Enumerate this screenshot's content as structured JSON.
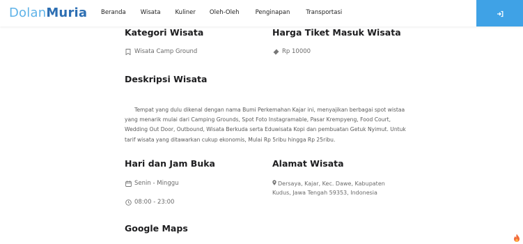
{
  "header": {
    "logo_part1": "Dolan",
    "logo_part2": "Muria",
    "nav": [
      "Beranda",
      "Wisata",
      "Kuliner",
      "Oleh-Oleh",
      "Penginapan",
      "Transportasi"
    ],
    "accent": "#3fa2e6"
  },
  "kategori": {
    "title": "Kategori Wisata",
    "value": "Wisata Camp Ground",
    "icon": "bookmark-icon"
  },
  "harga": {
    "title": "Harga Tiket Masuk Wisata",
    "value": "Rp 10000",
    "icon": "ticket-icon"
  },
  "deskripsi": {
    "title": "Deskripsi Wisata",
    "text": "Tempat yang dulu dikenal dengan nama Bumi Perkemahan Kajar ini, menyajikan berbagai spot wistaa yang menarik mulai dari Camping Grounds, Spot Foto Instagramable, Pasar Krempyeng, Food Court, Wedding Out Door, Outbound, Wisata Berkuda serta Eduwisata Kopi dan pembuatan Getuk Nyimut. Untuk tarif wisata yang ditawarkan cukup ekonomis, Mulai Rp 5ribu hingga Rp 25ribu."
  },
  "jam": {
    "title": "Hari dan Jam Buka",
    "days": "Senin - Minggu",
    "hours": "08:00 - 23:00"
  },
  "alamat": {
    "title": "Alamat Wisata",
    "text": "Dersaya, Kajar, Kec. Dawe, Kabupaten Kudus, Jawa Tengah 59353, Indonesia"
  },
  "maps": {
    "title": "Google Maps"
  }
}
